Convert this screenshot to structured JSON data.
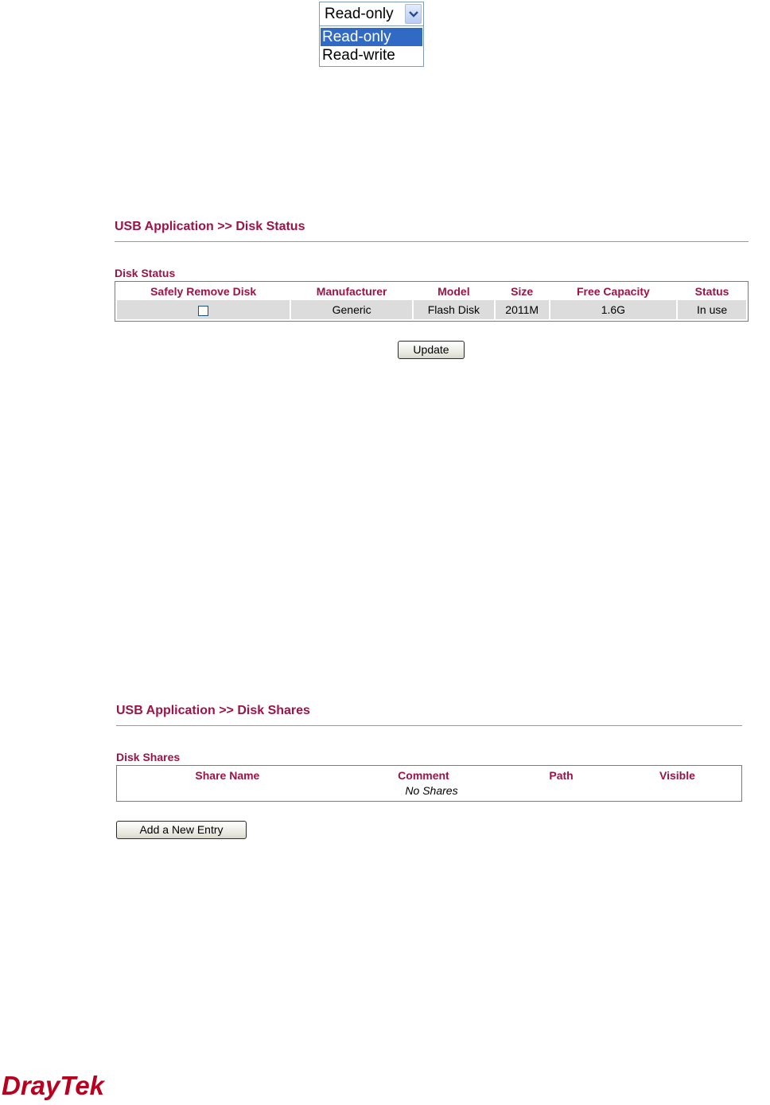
{
  "dropdown": {
    "value": "Read-only",
    "options": [
      "Read-only",
      "Read-write"
    ],
    "selected_index": 0
  },
  "disk_status_page": {
    "title": "USB Application >> Disk Status",
    "block_label": "Disk Status",
    "columns": [
      "Safely Remove Disk",
      "Manufacturer",
      "Model",
      "Size",
      "Free Capacity",
      "Status"
    ],
    "row": {
      "safely_remove": false,
      "manufacturer": "Generic",
      "model": "Flash Disk",
      "size": "2011M",
      "free_capacity": "1.6G",
      "status": "In use"
    },
    "update_button": "Update"
  },
  "disk_shares_page": {
    "title": "USB Application >> Disk Shares",
    "block_label": "Disk Shares",
    "columns": [
      "Share Name",
      "Comment",
      "Path",
      "Visible"
    ],
    "empty_text": "No Shares",
    "add_button": "Add a New Entry"
  },
  "logo": {
    "text": "DrayTek"
  },
  "colors": {
    "accent": "#9c1346",
    "logo": "#b8001f",
    "selected": "#316ac5"
  }
}
